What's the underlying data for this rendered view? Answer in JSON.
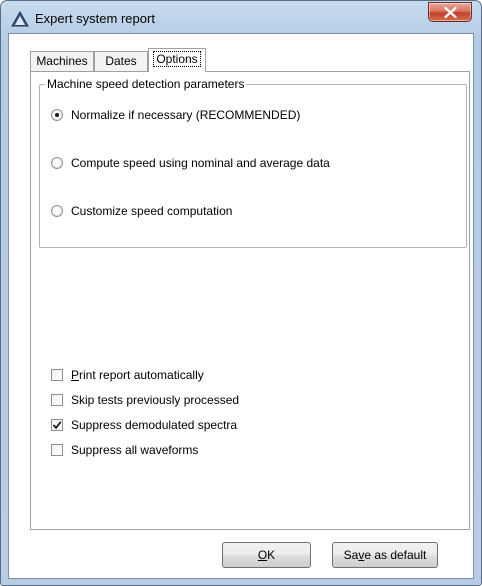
{
  "window": {
    "title": "Expert system report",
    "close_glyph": "close-x-icon"
  },
  "tabs": [
    {
      "label": "Machines",
      "active": false
    },
    {
      "label": "Dates",
      "active": false
    },
    {
      "label": "Options",
      "active": true
    }
  ],
  "speed_group": {
    "label": "Machine speed detection parameters",
    "options": [
      {
        "label": "Normalize if necessary (RECOMMENDED)",
        "checked": true
      },
      {
        "label": "Compute speed using nominal and average data",
        "checked": false
      },
      {
        "label": "Customize speed computation",
        "checked": false
      }
    ]
  },
  "checkboxes": [
    {
      "label_mnemonic": "P",
      "label_rest": "rint report automatically",
      "checked": false
    },
    {
      "label_mnemonic": "",
      "label_rest": "Skip tests previously processed",
      "checked": false
    },
    {
      "label_mnemonic": "",
      "label_rest": "Suppress demodulated spectra",
      "checked": true
    },
    {
      "label_mnemonic": "",
      "label_rest": "Suppress all waveforms",
      "checked": false
    }
  ],
  "buttons": {
    "ok": {
      "mnemonic": "O",
      "rest": "K"
    },
    "save_default": {
      "pre": "Sa",
      "mnemonic": "v",
      "rest": "e as default"
    }
  }
}
